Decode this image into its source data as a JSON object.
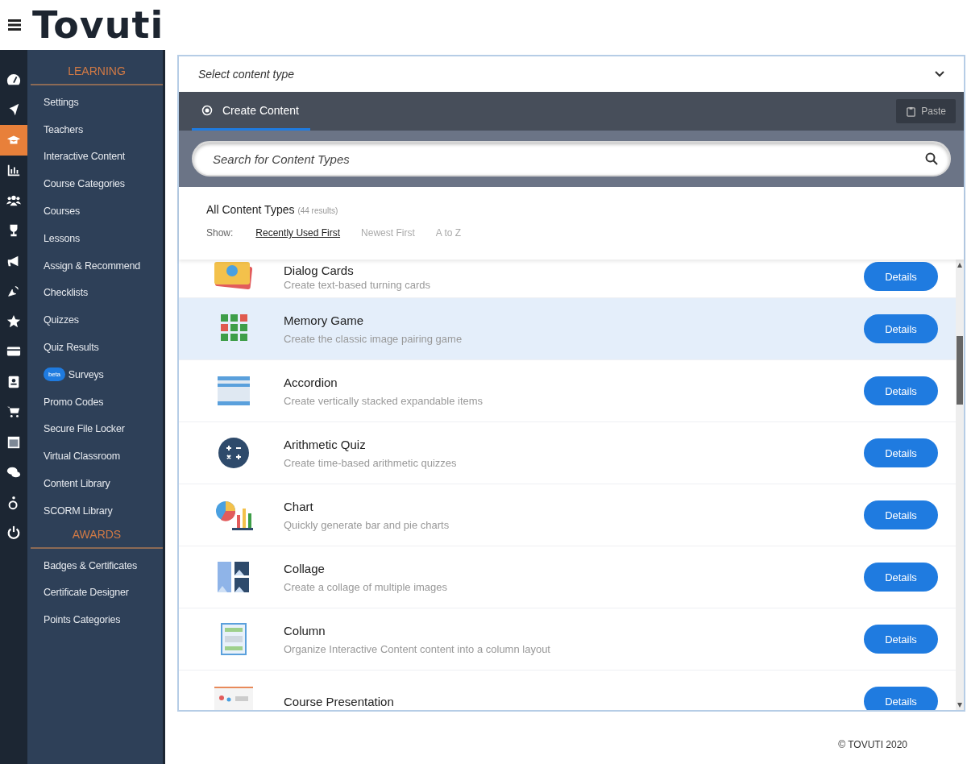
{
  "header": {
    "logo": "Tovuti"
  },
  "sidebar": {
    "icons": [
      {
        "selected": false
      },
      {
        "selected": false
      },
      {
        "selected": true
      },
      {
        "selected": false
      },
      {
        "selected": false
      },
      {
        "selected": false
      },
      {
        "selected": false
      },
      {
        "selected": false
      },
      {
        "selected": false
      },
      {
        "selected": false
      },
      {
        "selected": false
      },
      {
        "selected": false
      },
      {
        "selected": false
      },
      {
        "selected": false
      },
      {
        "selected": false
      },
      {
        "selected": false
      }
    ],
    "sections": [
      {
        "title": "LEARNING",
        "items": [
          {
            "label": "Settings"
          },
          {
            "label": "Teachers"
          },
          {
            "label": "Interactive Content"
          },
          {
            "label": "Course Categories"
          },
          {
            "label": "Courses"
          },
          {
            "label": "Lessons"
          },
          {
            "label": "Assign & Recommend"
          },
          {
            "label": "Checklists"
          },
          {
            "label": "Quizzes"
          },
          {
            "label": "Quiz Results"
          },
          {
            "label": "Surveys",
            "badge": "beta"
          },
          {
            "label": "Promo Codes"
          },
          {
            "label": "Secure File Locker"
          },
          {
            "label": "Virtual Classroom"
          },
          {
            "label": "Content Library"
          },
          {
            "label": "SCORM Library"
          }
        ]
      },
      {
        "title": "AWARDS",
        "items": [
          {
            "label": "Badges & Certificates"
          },
          {
            "label": "Certificate Designer"
          },
          {
            "label": "Points Categories"
          }
        ]
      }
    ]
  },
  "content_type_select": {
    "placeholder": "Select content type"
  },
  "tab": {
    "label": "Create Content"
  },
  "paste_button": "Paste",
  "search": {
    "placeholder": "Search for Content Types"
  },
  "list_header": {
    "title": "All Content Types",
    "count": "(44 results)",
    "show_label": "Show:",
    "sort_options": [
      {
        "label": "Recently Used First",
        "selected": true
      },
      {
        "label": "Newest First",
        "selected": false
      },
      {
        "label": "A to Z",
        "selected": false
      }
    ]
  },
  "content_types": [
    {
      "title": "Dialog Cards",
      "description": "Create text-based turning cards",
      "selected": false,
      "button": "Details"
    },
    {
      "title": "Memory Game",
      "description": "Create the classic image pairing game",
      "selected": true,
      "button": "Details"
    },
    {
      "title": "Accordion",
      "description": "Create vertically stacked expandable items",
      "selected": false,
      "button": "Details"
    },
    {
      "title": "Arithmetic Quiz",
      "description": "Create time-based arithmetic quizzes",
      "selected": false,
      "button": "Details"
    },
    {
      "title": "Chart",
      "description": "Quickly generate bar and pie charts",
      "selected": false,
      "button": "Details"
    },
    {
      "title": "Collage",
      "description": "Create a collage of multiple images",
      "selected": false,
      "button": "Details"
    },
    {
      "title": "Column",
      "description": "Organize Interactive Content content into a column layout",
      "selected": false,
      "button": "Details"
    },
    {
      "title": "Course Presentation",
      "selected": false,
      "button": "Details"
    }
  ],
  "footer": "© TOVUTI 2020"
}
